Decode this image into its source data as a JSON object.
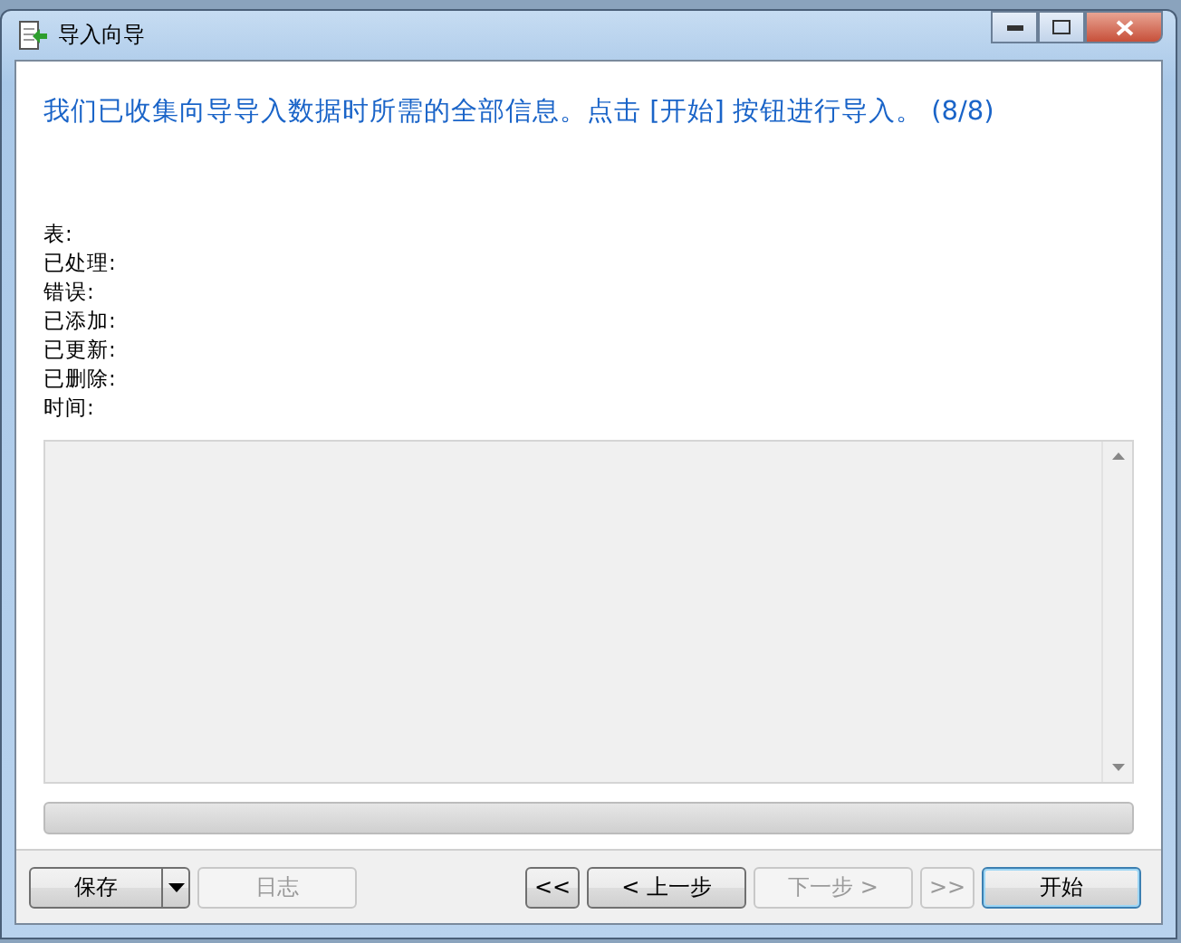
{
  "window": {
    "title": "导入向导"
  },
  "heading": "我们已收集向导导入数据时所需的全部信息。点击 [开始] 按钮进行导入。 (8/8)",
  "stats": [
    {
      "label": "表:"
    },
    {
      "label": "已处理:"
    },
    {
      "label": "错误:"
    },
    {
      "label": "已添加:"
    },
    {
      "label": "已更新:"
    },
    {
      "label": "已删除:"
    },
    {
      "label": "时间:"
    }
  ],
  "progress": {
    "level": 0
  },
  "buttons_left": [
    {
      "label": "保存",
      "kind": "split",
      "disabled": false
    },
    {
      "label": "日志",
      "kind": "plain",
      "disabled": true
    }
  ],
  "buttons_right": [
    {
      "label": "<<",
      "kind": "small",
      "disabled": false,
      "default": false
    },
    {
      "label": "< 上一步",
      "kind": "plain",
      "disabled": false,
      "default": false
    },
    {
      "label": "下一步 >",
      "kind": "plain",
      "disabled": true,
      "default": false
    },
    {
      "label": ">>",
      "kind": "small",
      "disabled": true,
      "default": false
    },
    {
      "label": "开始",
      "kind": "plain",
      "disabled": false,
      "default": true
    }
  ]
}
